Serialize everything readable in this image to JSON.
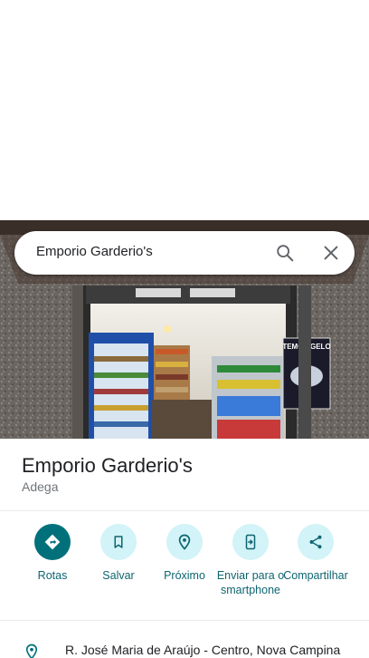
{
  "search": {
    "query": "Emporio Garderio's"
  },
  "hero": {
    "sign_text": "TEMOS GELO"
  },
  "place": {
    "name": "Emporio Garderio's",
    "category": "Adega",
    "address": "R. José Maria de Araújo - Centro, Nova Campina"
  },
  "actions": [
    {
      "label": "Rotas",
      "icon": "directions-icon"
    },
    {
      "label": "Salvar",
      "icon": "bookmark-icon"
    },
    {
      "label": "Próximo",
      "icon": "nearby-icon"
    },
    {
      "label": "Enviar para o smartphone",
      "icon": "send-to-phone-icon"
    },
    {
      "label": "Compartilhar",
      "icon": "share-icon"
    }
  ],
  "colors": {
    "accent": "#00717a",
    "action_bg": "#d2f3f7",
    "action_text": "#0e6570",
    "secondary_text": "#70757a"
  }
}
